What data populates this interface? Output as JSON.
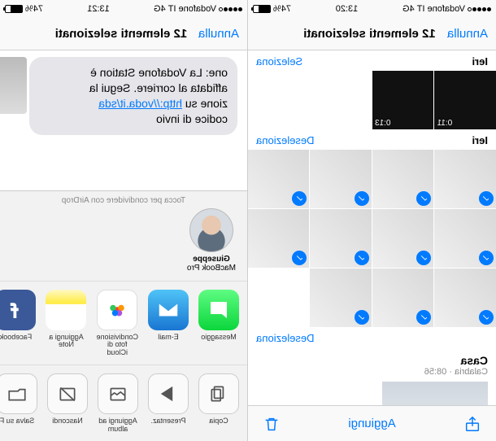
{
  "left": {
    "status": {
      "carrier": "Vodafone IT",
      "net": "4G",
      "time": "13:20",
      "batt": "74%"
    },
    "nav": {
      "cancel": "Annulla",
      "title": "12 elementi selezionati"
    },
    "sec1": {
      "label": "Ieri",
      "action": "Seleziona",
      "vid1": "0:11",
      "vid2": "0:13"
    },
    "sec2": {
      "label": "Ieri",
      "action": "Deseleziona"
    },
    "sec3": {
      "action": "Deseleziona"
    },
    "moment": {
      "loc": "Casa",
      "sub": "Calabria · 08:56"
    },
    "toolbar": {
      "add": "Aggiungi"
    }
  },
  "right": {
    "status": {
      "carrier": "Vodafone IT",
      "net": "4G",
      "time": "13:21",
      "batt": "74%"
    },
    "nav": {
      "cancel": "Annulla",
      "title": "12 elementi selezionati"
    },
    "msg": {
      "line1": "one: La Vodafone Station è",
      "line2": "affidata al corriere. Segui la",
      "line3_a": "zione su ",
      "link": "http://voda.it/sda",
      "line4": "codice di invio"
    },
    "airdrop_hint": "Tocca per condividere con AirDrop",
    "airdrop": {
      "name": "Giuseppe",
      "device": "MacBook Pro"
    },
    "apps": {
      "messages": "Messaggio",
      "mail": "E-mail",
      "icloud": "Condivisione foto di iCloud",
      "notes": "Aggiungi a Note",
      "facebook": "Facebook"
    },
    "actions": {
      "copy": "Copia",
      "slideshow": "Presentaz.",
      "addalbum": "Aggiungi ad album",
      "hide": "Nascondi",
      "savefiles": "Salva su F"
    }
  }
}
